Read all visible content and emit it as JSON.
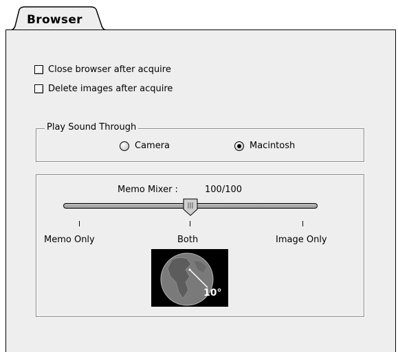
{
  "tab": {
    "label": "Browser"
  },
  "options": {
    "close_browser": {
      "label": "Close browser after acquire",
      "checked": false
    },
    "delete_images": {
      "label": "Delete images after acquire",
      "checked": false
    }
  },
  "sound_group": {
    "title": "Play Sound Through",
    "options": [
      {
        "label": "Camera",
        "selected": false
      },
      {
        "label": "Macintosh",
        "selected": true
      }
    ]
  },
  "memo_mixer": {
    "label": "Memo Mixer :",
    "value": "100/100",
    "level_fraction": 0.5,
    "ticks": [
      "Memo Only",
      "Both",
      "Image Only"
    ],
    "globe_label": "10°"
  },
  "colors": {
    "panel_bg": "#eeeeee",
    "globe_bg": "#000000",
    "globe_fill": "#7a7a7a"
  }
}
